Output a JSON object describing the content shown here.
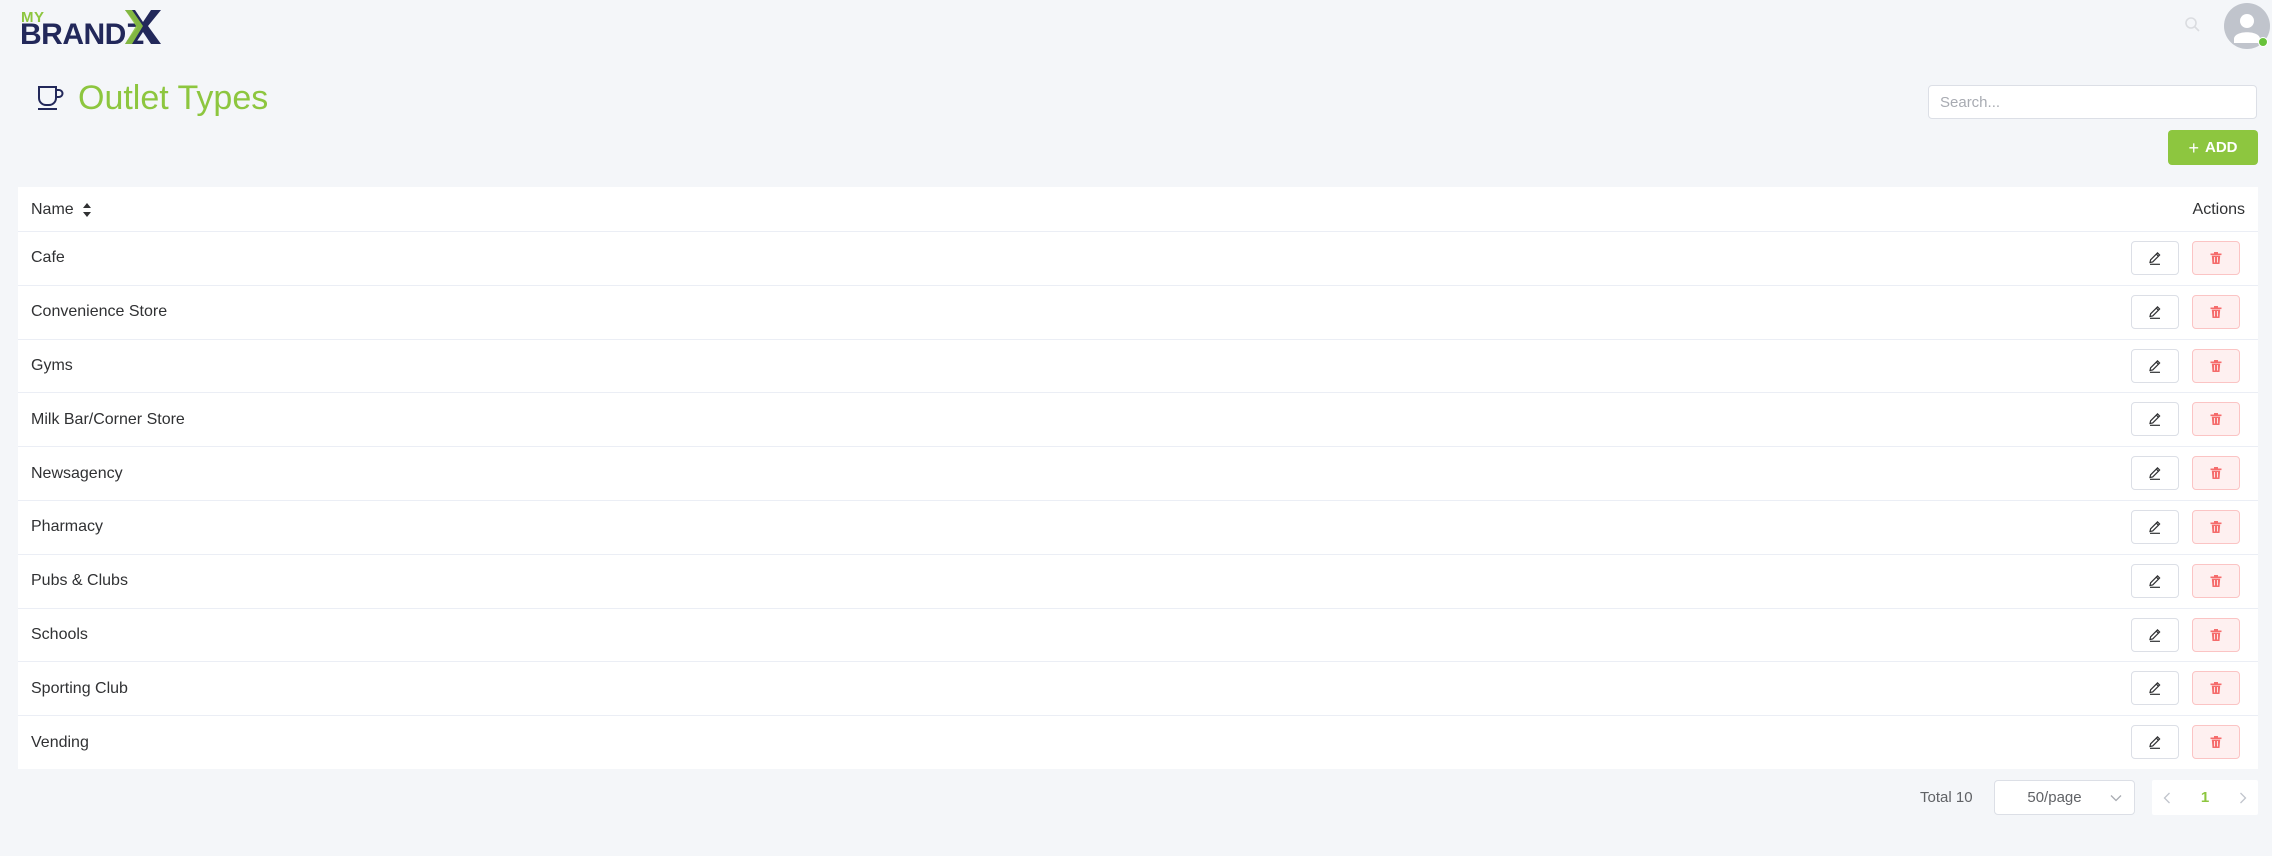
{
  "header": {
    "logo_top": "MY",
    "logo_main": "BRANDZ",
    "logo_x": "X"
  },
  "page": {
    "title": "Outlet Types",
    "title_icon": "coffee-cup-icon"
  },
  "search": {
    "placeholder": "Search..."
  },
  "toolbar": {
    "add_label": "ADD"
  },
  "table": {
    "columns": {
      "name": "Name",
      "actions": "Actions"
    },
    "rows": [
      {
        "name": "Cafe"
      },
      {
        "name": "Convenience Store"
      },
      {
        "name": "Gyms"
      },
      {
        "name": "Milk Bar/Corner Store"
      },
      {
        "name": "Newsagency"
      },
      {
        "name": "Pharmacy"
      },
      {
        "name": "Pubs & Clubs"
      },
      {
        "name": "Schools"
      },
      {
        "name": "Sporting Club"
      },
      {
        "name": "Vending"
      }
    ]
  },
  "pagination": {
    "total_label": "Total 10",
    "page_size": "50/page",
    "current_page": "1"
  },
  "colors": {
    "brand_green": "#8dc63f",
    "brand_navy": "#22285a",
    "danger": "#f56c6c"
  }
}
